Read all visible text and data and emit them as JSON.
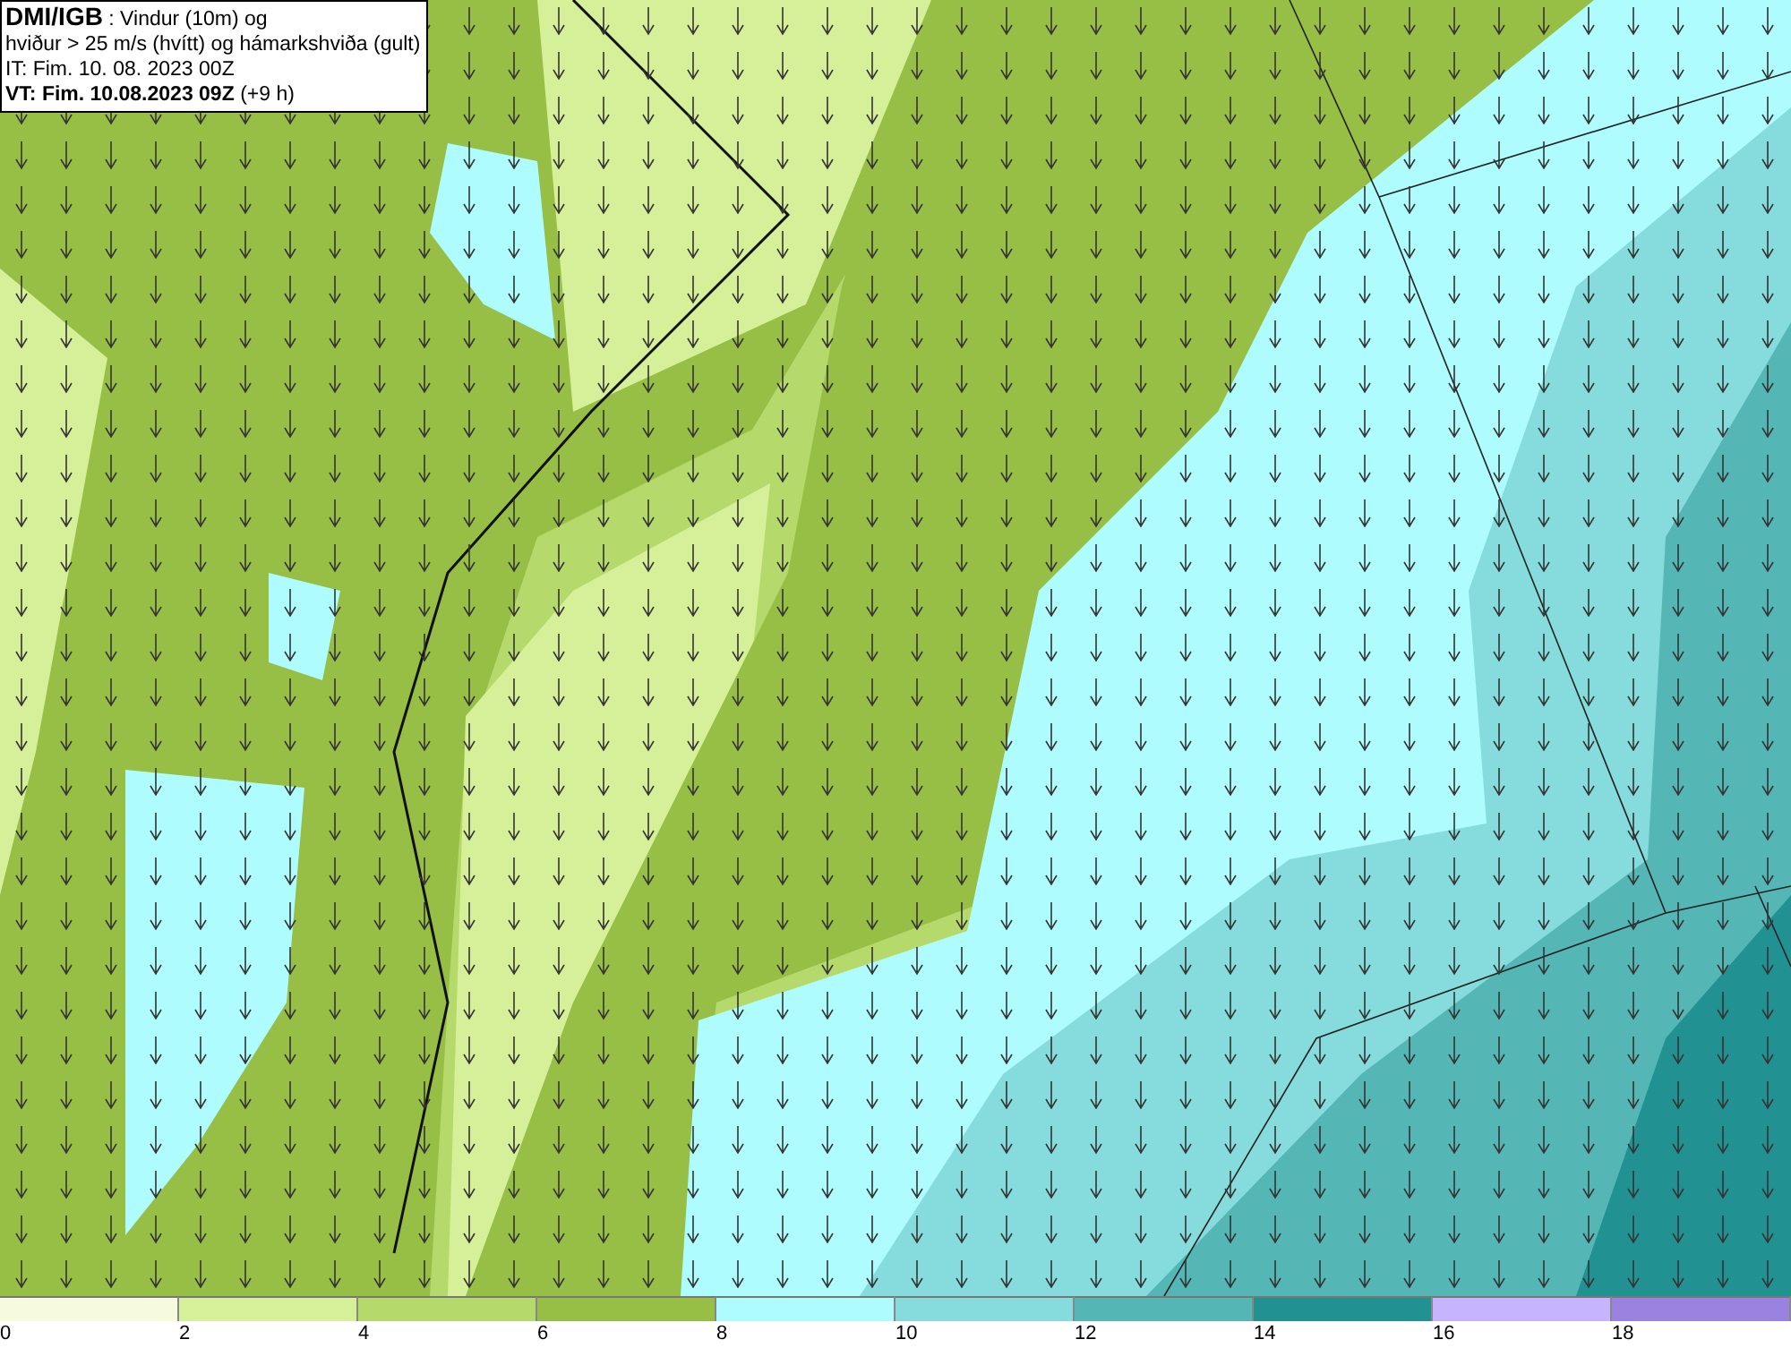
{
  "title_box": {
    "source": "DMI/IGB",
    "description": ": Vindur (10m) og",
    "line_2": "hviður > 25 m/s (hvítt) og hámarkshviða (gult)",
    "initial_time": "IT: Fim. 10. 08. 2023 00Z",
    "valid_time": "VT: Fim. 10.08.2023 09Z",
    "lead_time": "(+9 h)"
  },
  "legend": [
    {
      "label": "0",
      "color": "#f5fbdc"
    },
    {
      "label": "2",
      "color": "#d6ef99"
    },
    {
      "label": "4",
      "color": "#b5d96b"
    },
    {
      "label": "6",
      "color": "#97be45"
    },
    {
      "label": "8",
      "color": "#aefcfe"
    },
    {
      "label": "10",
      "color": "#86dcdc"
    },
    {
      "label": "12",
      "color": "#55b6b6"
    },
    {
      "label": "14",
      "color": "#229191"
    },
    {
      "label": "16",
      "color": "#c6b4ff"
    },
    {
      "label": "18",
      "color": "#9a82e0"
    }
  ]
}
